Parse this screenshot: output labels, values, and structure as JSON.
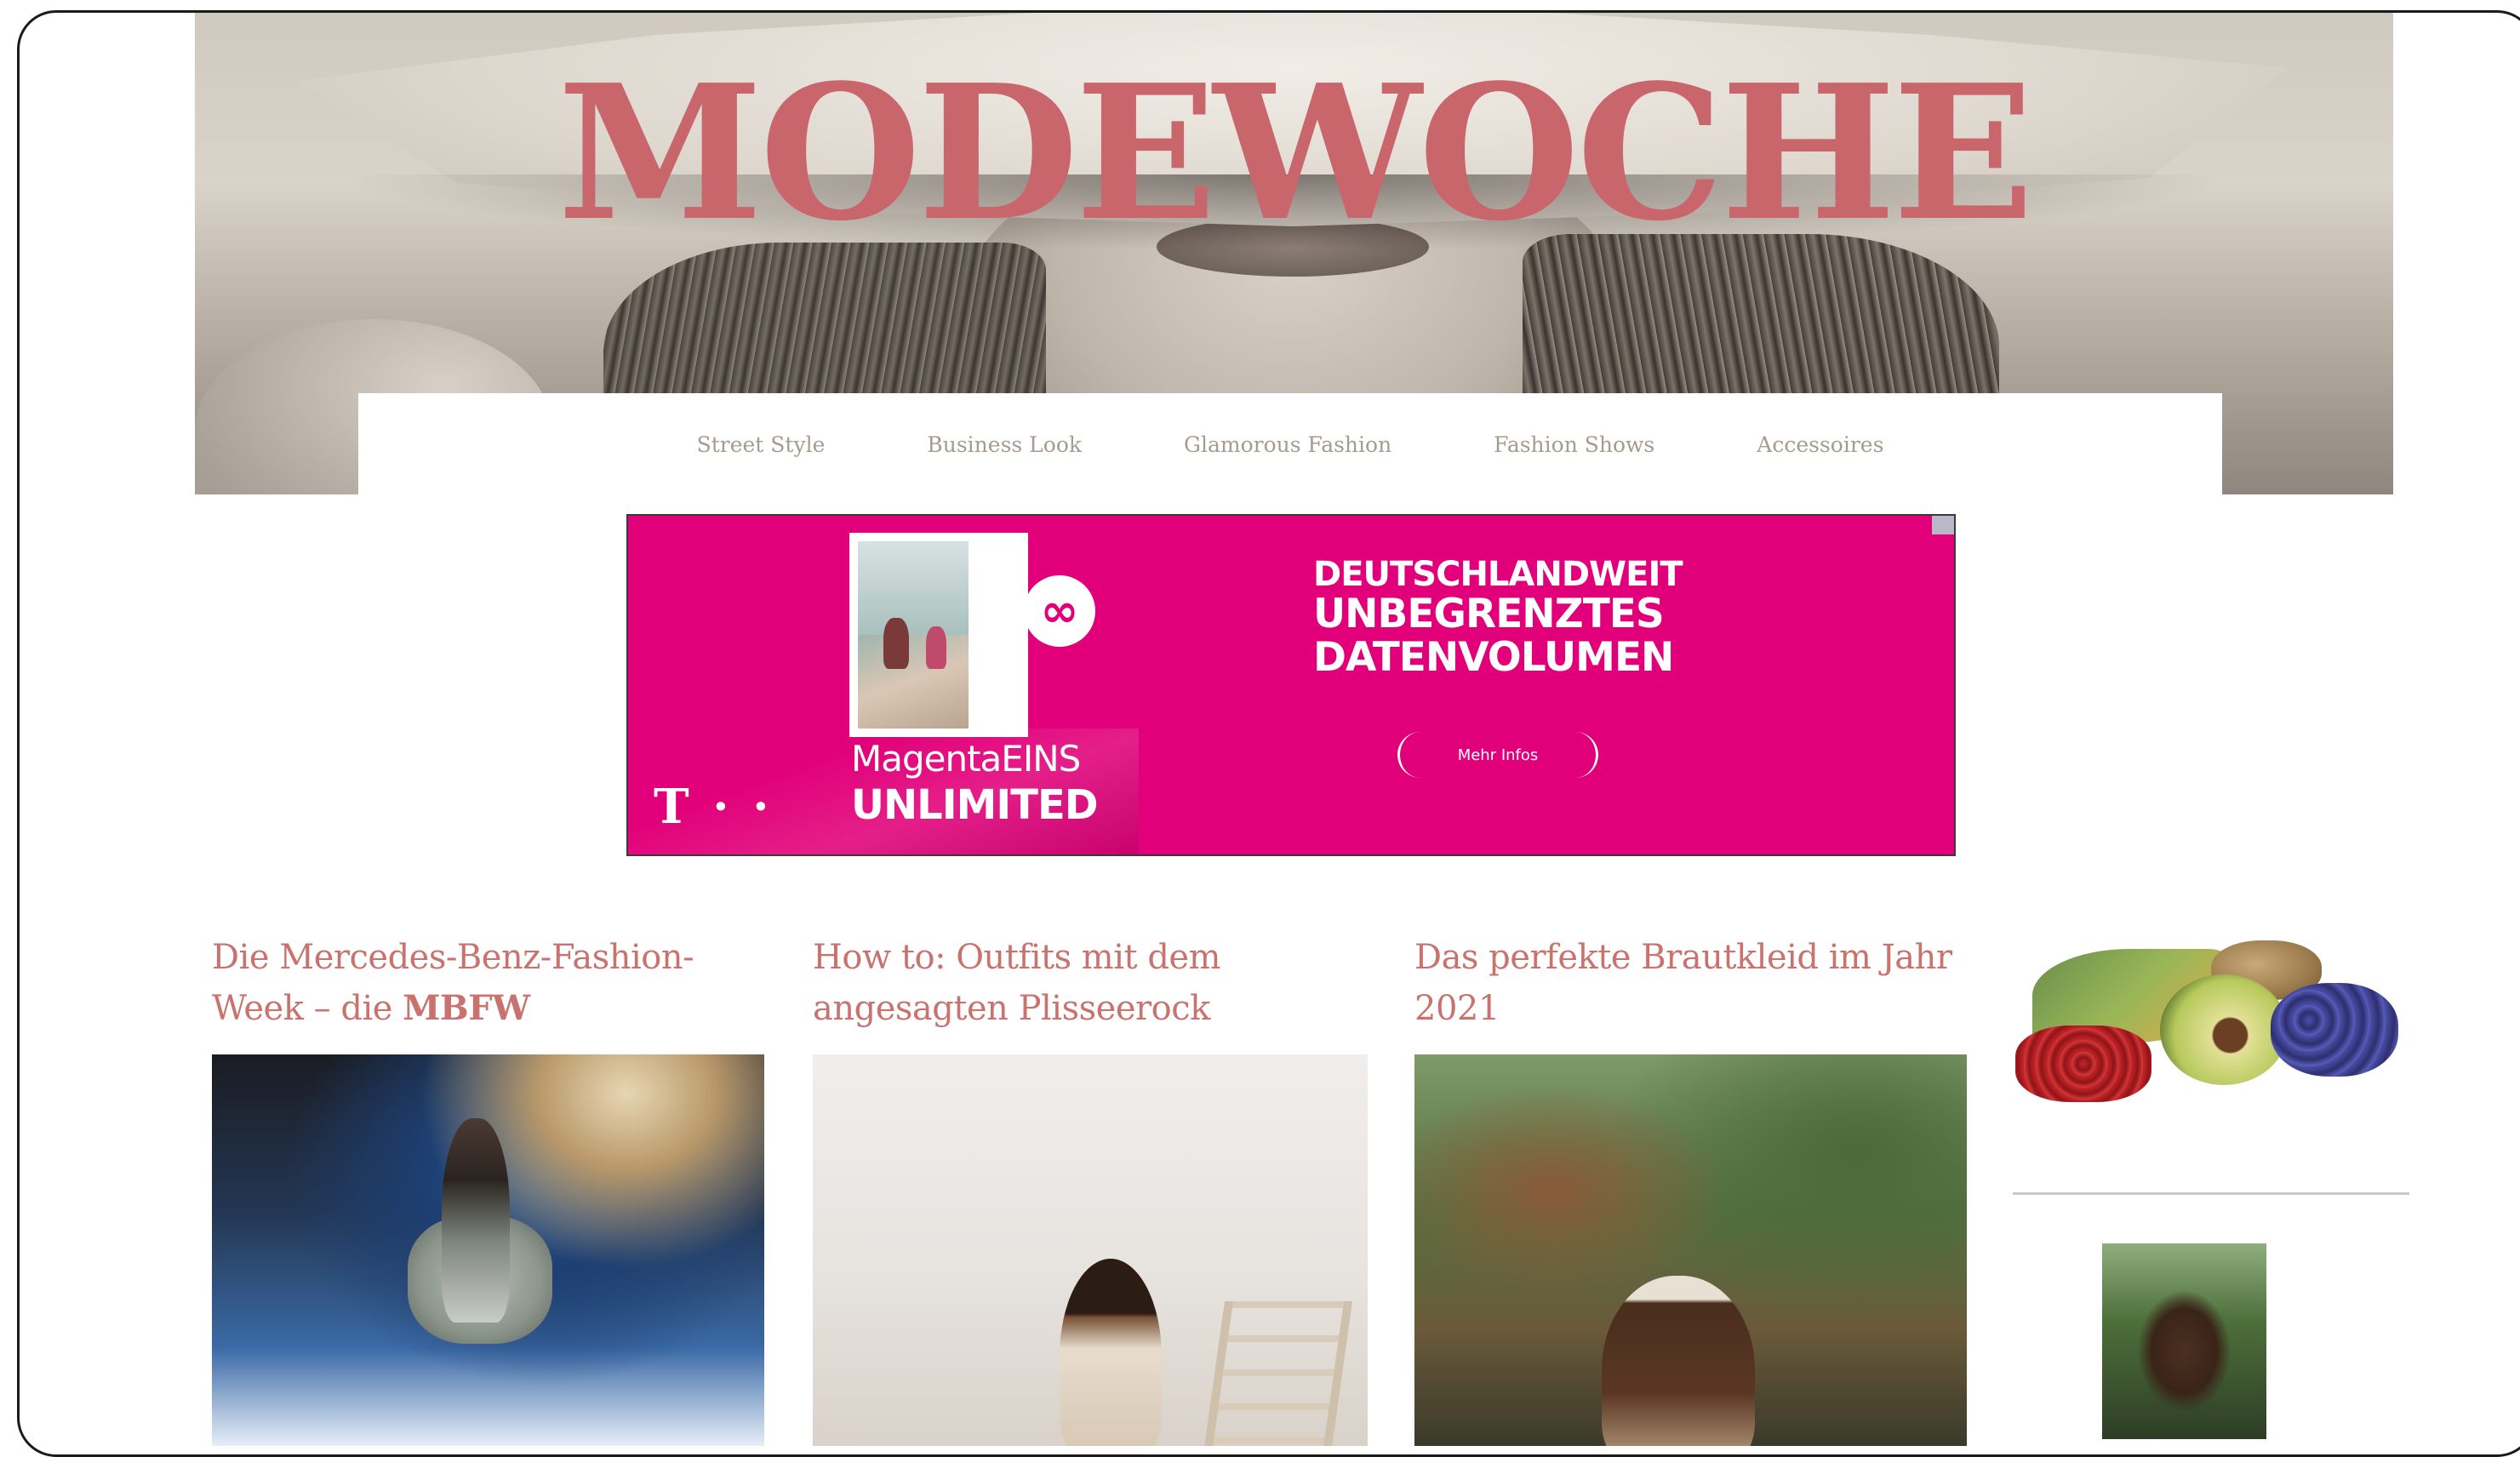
{
  "header": {
    "site_title": "MODEWOCHE"
  },
  "nav": {
    "items": [
      {
        "label": "Street Style"
      },
      {
        "label": "Business Look"
      },
      {
        "label": "Glamorous Fashion"
      },
      {
        "label": "Fashion Shows"
      },
      {
        "label": "Accessoires"
      }
    ]
  },
  "ad": {
    "brand_line1": "MagentaEINS",
    "brand_line2": "UNLIMITED",
    "headline": [
      "DEUTSCHLANDWEIT",
      "UNBEGRENZTES",
      "DATENVOLUMEN"
    ],
    "cta_label": "Mehr Infos",
    "telekom_mark": "T · ·",
    "infinity_symbol": "∞",
    "brand_color": "#e10079",
    "icons": [
      "magentaeins-logo-icon",
      "telekom-logo-icon",
      "ad-choices-icon"
    ]
  },
  "articles": [
    {
      "title_prefix": "Die Mercedes-Benz-Fashion-Week – die ",
      "title_bold": "MBFW",
      "image": "runway-photo"
    },
    {
      "title_prefix": "How to: Outfits mit dem angesagten Plisseerock",
      "title_bold": "",
      "image": "model-with-ladder-photo"
    },
    {
      "title_prefix": "Das perfekte Brautkleid im Jahr 2021",
      "title_bold": "",
      "image": "woman-in-garden-photo"
    }
  ],
  "sidebar": {
    "images": [
      "superfood-photo",
      "man-portrait-photo"
    ]
  },
  "colors": {
    "title_color": "#c8666c",
    "link_color": "#c9736f",
    "nav_text": "#a79a90"
  }
}
